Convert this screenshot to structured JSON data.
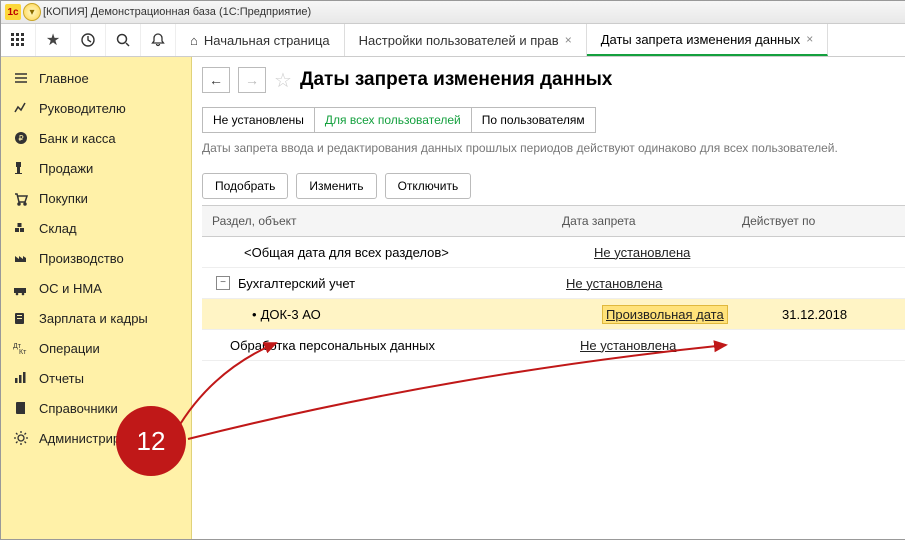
{
  "titlebar": {
    "title": "[КОПИЯ] Демонстрационная база (1С:Предприятие)"
  },
  "tabs": {
    "home": "Начальная страница",
    "t1": "Настройки пользователей и прав",
    "t2": "Даты запрета изменения данных"
  },
  "sidebar": {
    "items": [
      {
        "label": "Главное"
      },
      {
        "label": "Руководителю"
      },
      {
        "label": "Банк и касса"
      },
      {
        "label": "Продажи"
      },
      {
        "label": "Покупки"
      },
      {
        "label": "Склад"
      },
      {
        "label": "Производство"
      },
      {
        "label": "ОС и НМА"
      },
      {
        "label": "Зарплата и кадры"
      },
      {
        "label": "Операции"
      },
      {
        "label": "Отчеты"
      },
      {
        "label": "Справочники"
      },
      {
        "label": "Администрирование"
      }
    ]
  },
  "page": {
    "title": "Даты запрета изменения данных",
    "modes": {
      "m1": "Не установлены",
      "m2": "Для всех пользователей",
      "m3": "По пользователям"
    },
    "description": "Даты запрета ввода и редактирования данных прошлых периодов действуют одинаково для всех пользователей.",
    "actions": {
      "pick": "Подобрать",
      "edit": "Изменить",
      "off": "Отключить"
    },
    "grid": {
      "hdr": {
        "c1": "Раздел, объект",
        "c2": "Дата запрета",
        "c3": "Действует по"
      },
      "rows": [
        {
          "c1": "<Общая дата для всех разделов>",
          "c2": "Не установлена",
          "c3": ""
        },
        {
          "c1": "Бухгалтерский учет",
          "c2": "Не установлена",
          "c3": ""
        },
        {
          "c1": "ДОК-3 АО",
          "c2": "Произвольная дата",
          "c3": "31.12.2018"
        },
        {
          "c1": "Обработка персональных данных",
          "c2": "Не установлена",
          "c3": ""
        }
      ]
    }
  },
  "annotation": {
    "badge": "12"
  }
}
